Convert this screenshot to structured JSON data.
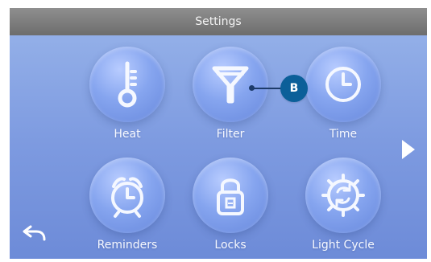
{
  "screen": {
    "title": "Settings",
    "accent_colors": {
      "background": "#7d9ae0",
      "titlebar": "#7d7d7d",
      "callout": "#0b5f99"
    }
  },
  "tiles": [
    {
      "label": "Heat",
      "icon": "thermometer-icon"
    },
    {
      "label": "Filter",
      "icon": "filter-icon"
    },
    {
      "label": "Time",
      "icon": "clock-icon"
    },
    {
      "label": "Reminders",
      "icon": "alarm-clock-icon"
    },
    {
      "label": "Locks",
      "icon": "lock-icon"
    },
    {
      "label": "Light Cycle",
      "icon": "light-cycle-icon"
    }
  ],
  "navigation": {
    "next_icon": "right-arrow-icon",
    "back_icon": "back-arrow-icon"
  },
  "callout": {
    "label": "B"
  }
}
